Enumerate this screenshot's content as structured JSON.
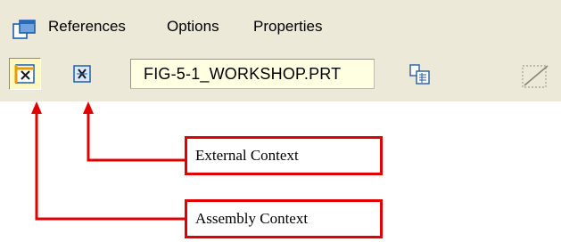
{
  "menu": {
    "items": [
      {
        "label": "References"
      },
      {
        "label": "Options"
      },
      {
        "label": "Properties"
      }
    ]
  },
  "toolbar": {
    "context_buttons": [
      {
        "name": "assembly-context",
        "state": "selected"
      },
      {
        "name": "external-context",
        "state": "unselected"
      }
    ],
    "model_name": "FIG-5-1_WORKSHOP.PRT"
  },
  "annotations": {
    "external": "External Context",
    "assembly": "Assembly Context",
    "color": "#e00000"
  },
  "colors": {
    "toolbar_bg": "#ece9d8",
    "field_bg": "#ffffe1",
    "active_btn_bg": "#fff7c0",
    "accent_red": "#e00000"
  }
}
